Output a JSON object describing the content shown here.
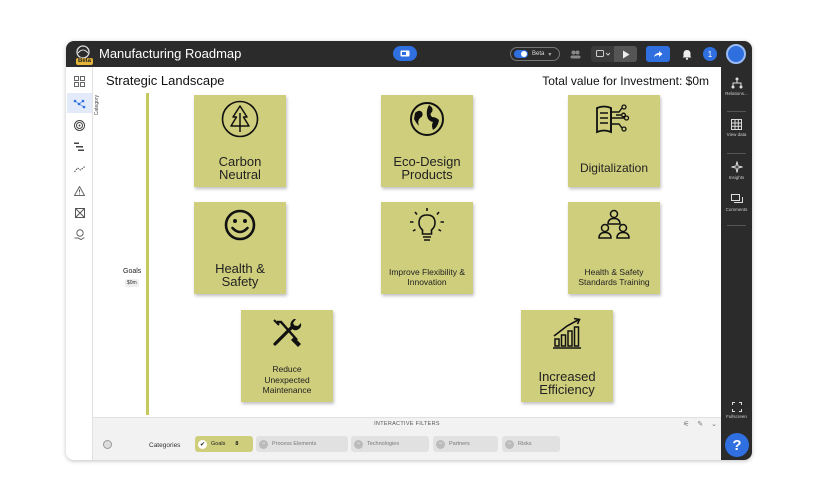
{
  "app": {
    "title": "Manufacturing Roadmap",
    "beta_badge": "Beta"
  },
  "toolbar": {
    "beta_toggle_label": "Beta",
    "notification_count": "1",
    "accent_color": "#2f6fe0"
  },
  "canvas": {
    "title": "Strategic Landscape",
    "investment_text": "Total value for Investment: $0m",
    "category_axis_label": "Category",
    "lane": {
      "label": "Goals",
      "value": "$0m"
    },
    "tile_color": "#cfce7c",
    "tiles": [
      {
        "label": "Carbon Neutral",
        "icon": "tree-icon"
      },
      {
        "label": "Eco-Design Products",
        "icon": "globe-icon"
      },
      {
        "label": "Digitalization",
        "icon": "digital-book-icon"
      },
      {
        "label": "Health & Safety",
        "icon": "smiley-icon"
      },
      {
        "label": "Improve Flexibility & Innovation",
        "icon": "lightbulb-icon"
      },
      {
        "label": "Health & Safety Standards Training",
        "icon": "team-icon"
      },
      {
        "label": "Reduce Unexpected Maintenance",
        "icon": "tools-icon"
      },
      {
        "label": "Increased Efficiency",
        "icon": "growth-chart-icon"
      }
    ]
  },
  "filters": {
    "title": "INTERACTIVE FILTERS",
    "categories_label": "Categories",
    "chips": [
      {
        "label": "Goals",
        "count": "8",
        "active": true
      },
      {
        "label": "Process Elements",
        "active": false
      },
      {
        "label": "Technologies",
        "active": false
      },
      {
        "label": "Partners",
        "active": false
      },
      {
        "label": "Risks",
        "active": false
      }
    ]
  },
  "rightbar": {
    "relations_label": "Relations...",
    "view_data_label": "View data",
    "insights_label": "Insights",
    "comments_label": "Comments",
    "fullscreen_label": "Fullscreen",
    "help_label": "?"
  }
}
